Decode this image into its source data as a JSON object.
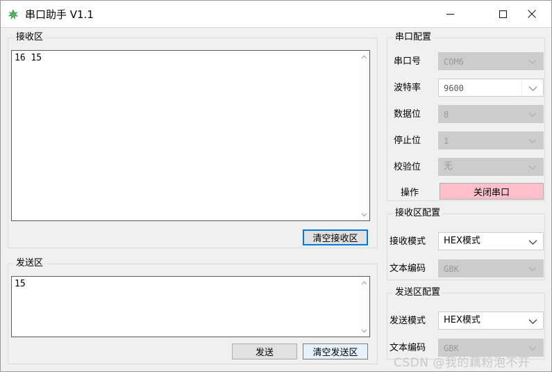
{
  "window": {
    "title": "串口助手 V1.1",
    "app_icon": "app-green-icon",
    "controls": {
      "minimize": "minimize-icon",
      "maximize": "maximize-icon",
      "close": "close-icon"
    }
  },
  "receive_area": {
    "group_title": "接收区",
    "content": "16 15",
    "clear_button": "清空接收区"
  },
  "send_area": {
    "group_title": "发送区",
    "content": "15",
    "send_button": "发送",
    "clear_button": "清空发送区"
  },
  "serial_config": {
    "group_title": "串口配置",
    "fields": [
      {
        "label": "串口号",
        "value": "COM6",
        "enabled": false,
        "cjk": false
      },
      {
        "label": "波特率",
        "value": "9600",
        "enabled": true,
        "cjk": false,
        "editable": true
      },
      {
        "label": "数据位",
        "value": "8",
        "enabled": false,
        "cjk": false
      },
      {
        "label": "停止位",
        "value": "1",
        "enabled": false,
        "cjk": false
      },
      {
        "label": "校验位",
        "value": "无",
        "enabled": false,
        "cjk": true
      }
    ],
    "action_label": "操作",
    "action_button": "关闭串口",
    "action_button_color": "#ffc0cb"
  },
  "receive_config": {
    "group_title": "接收区配置",
    "fields": [
      {
        "label": "接收模式",
        "value": "HEX模式",
        "enabled": true
      },
      {
        "label": "文本编码",
        "value": "GBK",
        "enabled": false
      }
    ]
  },
  "send_config": {
    "group_title": "发送区配置",
    "fields": [
      {
        "label": "发送模式",
        "value": "HEX模式",
        "enabled": true
      },
      {
        "label": "文本编码",
        "value": "GBK",
        "enabled": false
      }
    ]
  },
  "watermark": {
    "text": "CSDN @我的藕粉泡不开"
  }
}
